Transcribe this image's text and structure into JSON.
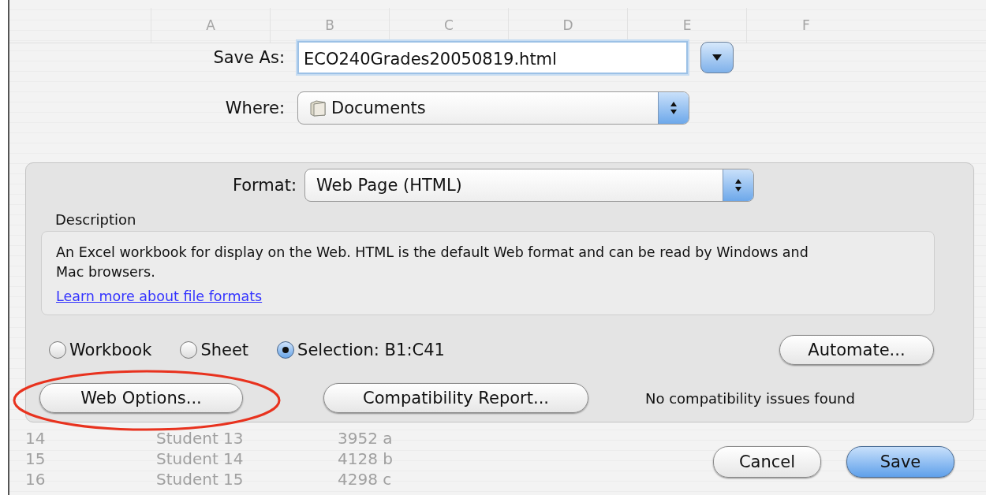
{
  "spreadsheet": {
    "columns": [
      "A",
      "B",
      "C",
      "D",
      "E",
      "F"
    ],
    "rows": [
      {
        "number": "14",
        "name": "Student 13",
        "value": "3952 a"
      },
      {
        "number": "15",
        "name": "Student 14",
        "value": "4128 b"
      },
      {
        "number": "16",
        "name": "Student 15",
        "value": "4298 c"
      }
    ]
  },
  "save_as": {
    "label": "Save As:",
    "value": "ECO240Grades20050819.html"
  },
  "where": {
    "label": "Where:",
    "value": "Documents"
  },
  "format": {
    "label": "Format:",
    "value": "Web Page (HTML)"
  },
  "description": {
    "label": "Description",
    "text": "An Excel workbook for display on the Web. HTML is the default Web format and can be read by Windows and Mac browsers.",
    "link": "Learn more about file formats"
  },
  "scope_options": [
    {
      "label": "Workbook",
      "selected": false
    },
    {
      "label": "Sheet",
      "selected": false
    },
    {
      "label": "Selection: B1:C41",
      "selected": true
    }
  ],
  "automate_button": "Automate...",
  "web_options_button": {
    "label": "Web Options...",
    "highlighted": true
  },
  "compatibility_button": "Compatibility Report...",
  "compatibility_status": "No compatibility issues found",
  "footer_buttons": [
    {
      "label": "Cancel",
      "default": false
    },
    {
      "label": "Save",
      "default": true
    }
  ]
}
